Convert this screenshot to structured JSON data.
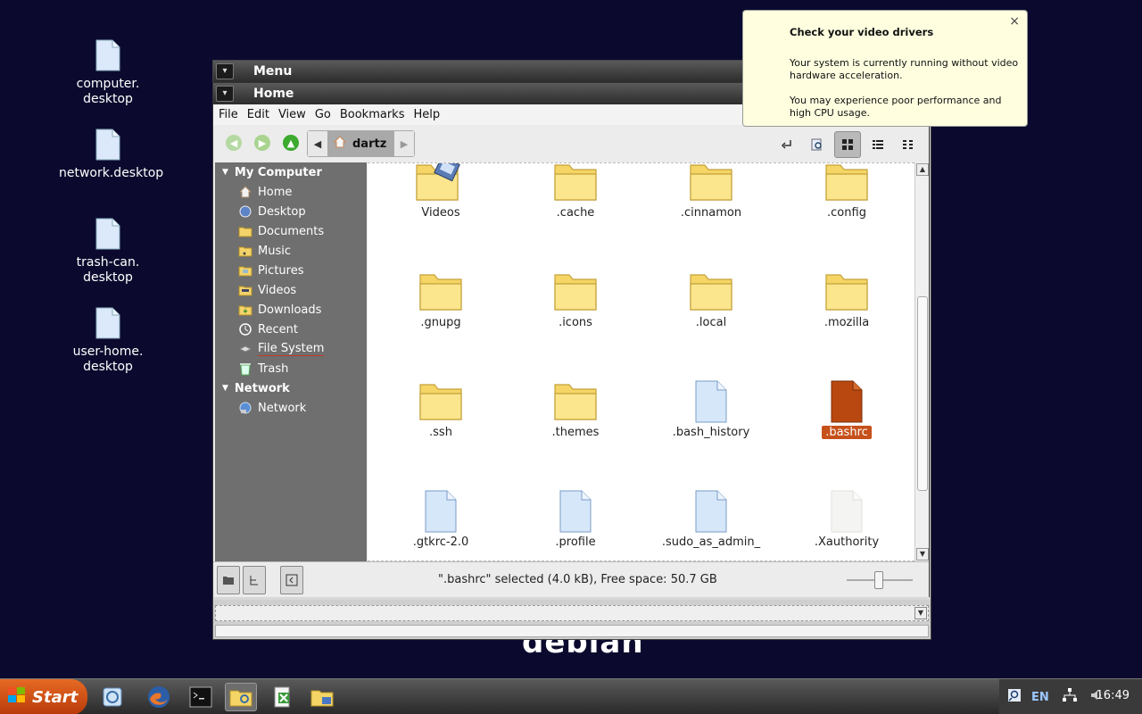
{
  "desktop": {
    "icons": [
      {
        "label": "computer.\ndesktop"
      },
      {
        "label": "network.desktop"
      },
      {
        "label": "trash-can.\ndesktop"
      },
      {
        "label": "user-home.\ndesktop"
      }
    ],
    "wallpaper_text": "debian"
  },
  "menu_window": {
    "title": "Menu"
  },
  "file_manager": {
    "title": "Home",
    "menubar": [
      "File",
      "Edit",
      "View",
      "Go",
      "Bookmarks",
      "Help"
    ],
    "breadcrumb": "dartz",
    "sidebar": {
      "my_computer_label": "My Computer",
      "items": [
        "Home",
        "Desktop",
        "Documents",
        "Music",
        "Pictures",
        "Videos",
        "Downloads",
        "Recent",
        "File System",
        "Trash"
      ],
      "network_label": "Network",
      "network_items": [
        "Network"
      ]
    },
    "files": [
      {
        "name": "Videos",
        "type": "folder-video"
      },
      {
        "name": ".cache",
        "type": "folder"
      },
      {
        "name": ".cinnamon",
        "type": "folder"
      },
      {
        "name": ".config",
        "type": "folder"
      },
      {
        "name": ".gnupg",
        "type": "folder"
      },
      {
        "name": ".icons",
        "type": "folder"
      },
      {
        "name": ".local",
        "type": "folder"
      },
      {
        "name": ".mozilla",
        "type": "folder"
      },
      {
        "name": ".ssh",
        "type": "folder"
      },
      {
        "name": ".themes",
        "type": "folder"
      },
      {
        "name": ".bash_history",
        "type": "file"
      },
      {
        "name": ".bashrc",
        "type": "file-selected"
      },
      {
        "name": ".gtkrc-2.0",
        "type": "file"
      },
      {
        "name": ".profile",
        "type": "file"
      },
      {
        "name": ".sudo_as_admin_",
        "type": "file"
      },
      {
        "name": ".Xauthority",
        "type": "file-blank"
      }
    ],
    "status": "\".bashrc\" selected (4.0 kB), Free space: 50.7 GB"
  },
  "notification": {
    "title": "Check your video drivers",
    "line1": "Your system is currently running without video hardware acceleration.",
    "line2": "You may experience poor performance and high CPU usage.",
    "close": "×"
  },
  "taskbar": {
    "start_label": "Start",
    "lang": "EN",
    "clock": "16:49"
  },
  "colors": {
    "selection": "#c6511a",
    "desktop_bg": "#0b0a2e",
    "notification_bg": "#ffffe0"
  }
}
